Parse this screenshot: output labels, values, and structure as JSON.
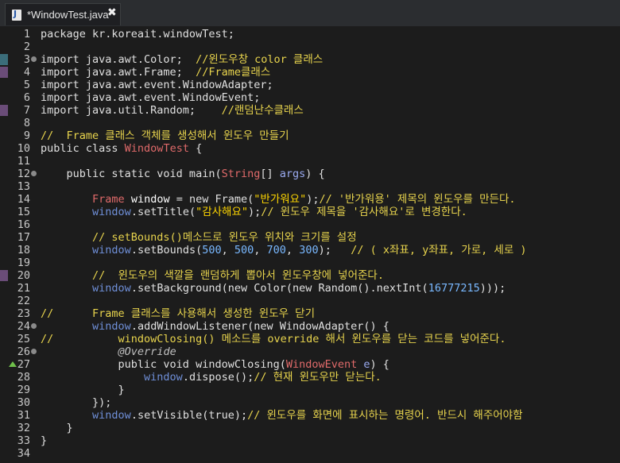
{
  "tab": {
    "title": "*WindowTest.java",
    "close_label": "✖",
    "icon": "java-file-icon"
  },
  "colors": {
    "background": "#1c1c1c",
    "comment": "#e8d44d",
    "field": "#6f8fd8",
    "type": "#e06a6a",
    "number": "#79b8ff",
    "plain": "#e0e0e0"
  },
  "lines": [
    {
      "num": "1",
      "fold": false,
      "mark": "",
      "segs": [
        [
          "p",
          "package kr.koreait.windowTest;"
        ]
      ]
    },
    {
      "num": "2",
      "fold": false,
      "mark": "",
      "segs": []
    },
    {
      "num": "3",
      "fold": true,
      "mark": "teal",
      "segs": [
        [
          "p",
          "import java.awt.Color;  "
        ],
        [
          "cm",
          "//윈도우창 color 클래스"
        ]
      ]
    },
    {
      "num": "4",
      "fold": false,
      "mark": "purple",
      "segs": [
        [
          "p",
          "import java.awt.Frame;  "
        ],
        [
          "cm",
          "//Frame클래스"
        ]
      ]
    },
    {
      "num": "5",
      "fold": false,
      "mark": "",
      "segs": [
        [
          "p",
          "import java.awt.event.WindowAdapter;"
        ]
      ]
    },
    {
      "num": "6",
      "fold": false,
      "mark": "",
      "segs": [
        [
          "p",
          "import java.awt.event.WindowEvent;"
        ]
      ]
    },
    {
      "num": "7",
      "fold": false,
      "mark": "purple",
      "segs": [
        [
          "p",
          "import java.util.Random;    "
        ],
        [
          "cm",
          "//랜덤난수클래스"
        ]
      ]
    },
    {
      "num": "8",
      "fold": false,
      "mark": "",
      "segs": []
    },
    {
      "num": "9",
      "fold": false,
      "mark": "",
      "segs": [
        [
          "cm",
          "//  Frame 클래스 객체를 생성해서 윈도우 만들기"
        ]
      ]
    },
    {
      "num": "10",
      "fold": false,
      "mark": "",
      "segs": [
        [
          "p",
          "public class "
        ],
        [
          "ty",
          "WindowTest"
        ],
        [
          "p",
          " {"
        ]
      ]
    },
    {
      "num": "11",
      "fold": false,
      "mark": "",
      "segs": []
    },
    {
      "num": "12",
      "fold": true,
      "mark": "",
      "segs": [
        [
          "p",
          "    public static void main("
        ],
        [
          "ty",
          "String"
        ],
        [
          "p",
          "[] "
        ],
        [
          "par",
          "args"
        ],
        [
          "p",
          ") {"
        ]
      ]
    },
    {
      "num": "13",
      "fold": false,
      "mark": "",
      "segs": []
    },
    {
      "num": "14",
      "fold": false,
      "mark": "",
      "segs": [
        [
          "p",
          "        "
        ],
        [
          "ty",
          "Frame"
        ],
        [
          "p",
          " "
        ],
        [
          "def",
          "window"
        ],
        [
          "p",
          " = new Frame("
        ],
        [
          "str",
          "\"반가워요\""
        ],
        [
          "p",
          ");"
        ],
        [
          "cm",
          "// '반가워용' 제목의 윈도우를 만든다."
        ]
      ]
    },
    {
      "num": "15",
      "fold": false,
      "mark": "",
      "segs": [
        [
          "p",
          "        "
        ],
        [
          "fld",
          "window"
        ],
        [
          "p",
          ".setTitle("
        ],
        [
          "str",
          "\"감사해요\""
        ],
        [
          "p",
          ");"
        ],
        [
          "cm",
          "// 윈도우 제목을 '감사해요'로 변경한다."
        ]
      ]
    },
    {
      "num": "16",
      "fold": false,
      "mark": "",
      "segs": []
    },
    {
      "num": "17",
      "fold": false,
      "mark": "",
      "segs": [
        [
          "p",
          "        "
        ],
        [
          "cm",
          "// setBounds()메소드로 윈도우 위치와 크기를 설정"
        ]
      ]
    },
    {
      "num": "18",
      "fold": false,
      "mark": "",
      "segs": [
        [
          "p",
          "        "
        ],
        [
          "fld",
          "window"
        ],
        [
          "p",
          ".setBounds("
        ],
        [
          "num",
          "500"
        ],
        [
          "p",
          ", "
        ],
        [
          "num",
          "500"
        ],
        [
          "p",
          ", "
        ],
        [
          "num",
          "700"
        ],
        [
          "p",
          ", "
        ],
        [
          "num",
          "300"
        ],
        [
          "p",
          ");   "
        ],
        [
          "cm",
          "// ( x좌표, y좌표, 가로, 세로 )"
        ]
      ]
    },
    {
      "num": "19",
      "fold": false,
      "mark": "",
      "segs": []
    },
    {
      "num": "20",
      "fold": false,
      "mark": "purple",
      "segs": [
        [
          "p",
          "        "
        ],
        [
          "cm",
          "//  윈도우의 색깔을 랜덤하게 뽑아서 윈도우창에 넣어준다."
        ]
      ]
    },
    {
      "num": "21",
      "fold": false,
      "mark": "",
      "segs": [
        [
          "p",
          "        "
        ],
        [
          "fld",
          "window"
        ],
        [
          "p",
          ".setBackground(new Color(new Random().nextInt("
        ],
        [
          "num",
          "16777215"
        ],
        [
          "p",
          ")));"
        ]
      ]
    },
    {
      "num": "22",
      "fold": false,
      "mark": "",
      "segs": []
    },
    {
      "num": "23",
      "fold": false,
      "mark": "",
      "segs": [
        [
          "cm",
          "//      Frame 클래스를 사용해서 생성한 윈도우 닫기"
        ]
      ]
    },
    {
      "num": "24",
      "fold": true,
      "mark": "",
      "segs": [
        [
          "p",
          "        "
        ],
        [
          "fld",
          "window"
        ],
        [
          "p",
          ".addWindowListener(new WindowAdapter() {"
        ]
      ]
    },
    {
      "num": "25",
      "fold": false,
      "mark": "",
      "segs": [
        [
          "cm",
          "//          windowClosing() 메소드를 override 해서 윈도우를 닫는 코드를 넣어준다."
        ]
      ]
    },
    {
      "num": "26",
      "fold": true,
      "mark": "",
      "segs": [
        [
          "p",
          "            "
        ],
        [
          "ann",
          "@Override"
        ]
      ]
    },
    {
      "num": "27",
      "fold": false,
      "mark": "warn",
      "segs": [
        [
          "p",
          "            public void windowClosing("
        ],
        [
          "ty",
          "WindowEvent"
        ],
        [
          "p",
          " "
        ],
        [
          "par",
          "e"
        ],
        [
          "p",
          ") {"
        ]
      ]
    },
    {
      "num": "28",
      "fold": false,
      "mark": "",
      "segs": [
        [
          "p",
          "                "
        ],
        [
          "fld",
          "window"
        ],
        [
          "p",
          ".dispose();"
        ],
        [
          "cm",
          "// 현재 윈도우만 닫는다."
        ]
      ]
    },
    {
      "num": "29",
      "fold": false,
      "mark": "",
      "segs": [
        [
          "p",
          "            }"
        ]
      ]
    },
    {
      "num": "30",
      "fold": false,
      "mark": "",
      "segs": [
        [
          "p",
          "        });"
        ]
      ]
    },
    {
      "num": "31",
      "fold": false,
      "mark": "",
      "segs": [
        [
          "p",
          "        "
        ],
        [
          "fld",
          "window"
        ],
        [
          "p",
          ".setVisible(true);"
        ],
        [
          "cm",
          "// 윈도우를 화면에 표시하는 명령어. 반드시 해주어야함"
        ]
      ]
    },
    {
      "num": "32",
      "fold": false,
      "mark": "",
      "segs": [
        [
          "p",
          "    }"
        ]
      ]
    },
    {
      "num": "33",
      "fold": false,
      "mark": "",
      "segs": [
        [
          "p",
          "}"
        ]
      ]
    },
    {
      "num": "34",
      "fold": false,
      "mark": "",
      "segs": []
    }
  ]
}
